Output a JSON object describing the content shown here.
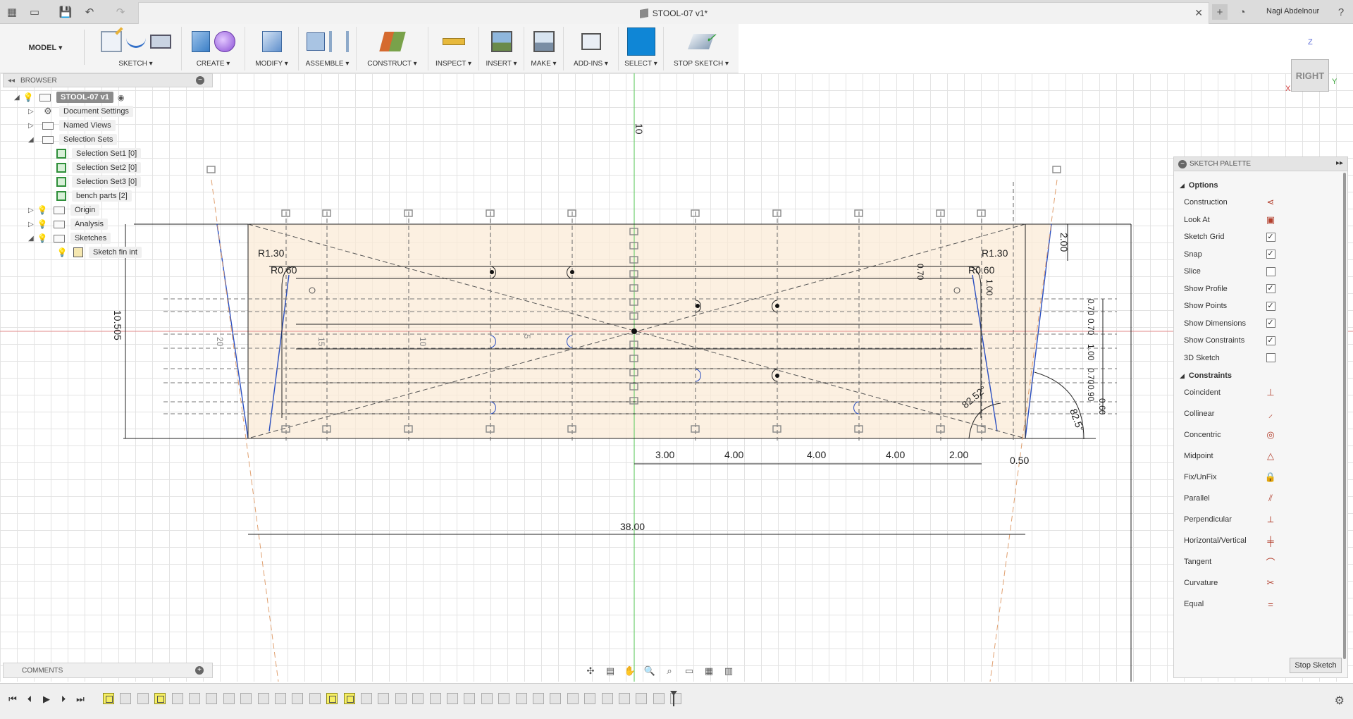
{
  "window": {
    "doc_title": "STOOL-07 v1*",
    "user_name": "Nagi Abdelnour",
    "close_glyph": "✕",
    "add_glyph": "+",
    "help_glyph": "?"
  },
  "toolbar": {
    "workspace": "MODEL ▾",
    "groups": {
      "sketch": "SKETCH ▾",
      "create": "CREATE ▾",
      "modify": "MODIFY ▾",
      "assemble": "ASSEMBLE ▾",
      "construct": "CONSTRUCT ▾",
      "inspect": "INSPECT ▾",
      "insert": "INSERT ▾",
      "make": "MAKE ▾",
      "addins": "ADD-INS ▾",
      "select": "SELECT ▾",
      "stop_sketch": "STOP SKETCH ▾"
    }
  },
  "browser": {
    "header": "BROWSER",
    "root": "STOOL-07 v1",
    "document_settings": "Document Settings",
    "named_views": "Named Views",
    "selection_sets": "Selection Sets",
    "sel1": "Selection Set1 [0]",
    "sel2": "Selection Set2 [0]",
    "sel3": "Selection Set3 [0]",
    "bench": "bench parts [2]",
    "origin": "Origin",
    "analysis": "Analysis",
    "sketches": "Sketches",
    "sketch_item": "Sketch fin int"
  },
  "comments": {
    "label": "COMMENTS"
  },
  "viewcube": {
    "face": "RIGHT",
    "z": "Z",
    "y": "Y",
    "x": "X"
  },
  "palette": {
    "title": "SKETCH PALETTE",
    "options_label": "Options",
    "constraints_label": "Constraints",
    "options": [
      {
        "label": "Construction",
        "type": "icon",
        "icon": "construction-icon",
        "glyph": "⋖"
      },
      {
        "label": "Look At",
        "type": "icon",
        "icon": "look-at-icon",
        "glyph": "▣"
      },
      {
        "label": "Sketch Grid",
        "type": "check",
        "checked": true
      },
      {
        "label": "Snap",
        "type": "check",
        "checked": true
      },
      {
        "label": "Slice",
        "type": "check",
        "checked": false
      },
      {
        "label": "Show Profile",
        "type": "check",
        "checked": true
      },
      {
        "label": "Show Points",
        "type": "check",
        "checked": true
      },
      {
        "label": "Show Dimensions",
        "type": "check",
        "checked": true
      },
      {
        "label": "Show Constraints",
        "type": "check",
        "checked": true
      },
      {
        "label": "3D Sketch",
        "type": "check",
        "checked": false
      }
    ],
    "constraints": [
      {
        "label": "Coincident",
        "icon": "coincident-icon",
        "glyph": "⊥"
      },
      {
        "label": "Collinear",
        "icon": "collinear-icon",
        "glyph": "⸝"
      },
      {
        "label": "Concentric",
        "icon": "concentric-icon",
        "glyph": "◎"
      },
      {
        "label": "Midpoint",
        "icon": "midpoint-icon",
        "glyph": "△"
      },
      {
        "label": "Fix/UnFix",
        "icon": "lock-icon",
        "glyph": "🔒"
      },
      {
        "label": "Parallel",
        "icon": "parallel-icon",
        "glyph": "⫽"
      },
      {
        "label": "Perpendicular",
        "icon": "perpendicular-icon",
        "glyph": "⟂"
      },
      {
        "label": "Horizontal/Vertical",
        "icon": "horizontal-vertical-icon",
        "glyph": "╪"
      },
      {
        "label": "Tangent",
        "icon": "tangent-icon",
        "glyph": "⌒"
      },
      {
        "label": "Curvature",
        "icon": "curvature-icon",
        "glyph": "✂"
      },
      {
        "label": "Equal",
        "icon": "equal-icon",
        "glyph": "="
      }
    ],
    "stop_button": "Stop Sketch"
  },
  "sketch": {
    "dims": {
      "d10_top": "10",
      "r130_left": "R1.30",
      "r060_left": "R0.60",
      "r130_right": "R1.30",
      "r060_right": "R0.60",
      "d2_right": "2.00",
      "d10505": "10.505",
      "d3": "3.00",
      "d4a": "4.00",
      "d4b": "4.00",
      "d4c": "4.00",
      "d2b": "2.00",
      "d050": "0.50",
      "d38": "38.00",
      "a8252": "82.52°",
      "a825": "82.5°",
      "d070": "0.70",
      "d100": "1.00",
      "d070b": "0.70",
      "d070c": "0.70",
      "d100b": "1.00",
      "d070d": "0.70",
      "d090": "0.90",
      "d060": "0.60",
      "ax15": "15",
      "ax10": "10",
      "ax5": "5",
      "ax20": "20"
    }
  },
  "timeline": {
    "first": "⏮",
    "prev": "⏴",
    "play": "▶",
    "next": "⏵",
    "last": "⏭",
    "settings": "⚙"
  }
}
